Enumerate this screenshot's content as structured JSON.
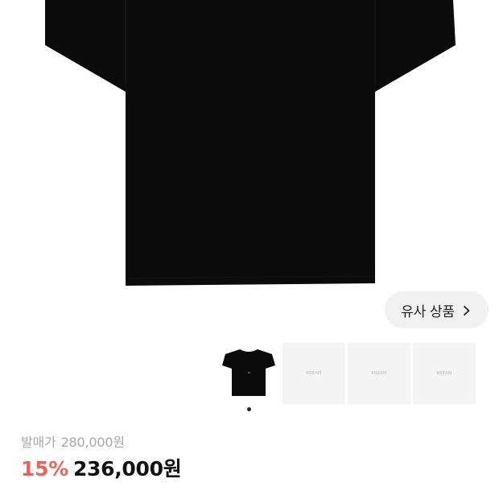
{
  "product": {
    "main_image": "black-tshirt",
    "thumbnails": [
      {
        "image": "black-tshirt",
        "brand": ""
      },
      {
        "image": "placeholder",
        "brand": "KREAM"
      },
      {
        "image": "placeholder",
        "brand": "KREAM"
      },
      {
        "image": "placeholder",
        "brand": "KREAM"
      }
    ],
    "active_index": 0
  },
  "similar": {
    "label": "유사 상품",
    "icon": "chevron-right-icon"
  },
  "price": {
    "original_label": "발매가",
    "original_value": "280,000원",
    "discount": "15%",
    "sale_value": "236,000원"
  },
  "colors": {
    "discount": "#ef6253",
    "text": "#111111",
    "muted": "#a8a8a8",
    "pill": "#f1f1f1"
  }
}
